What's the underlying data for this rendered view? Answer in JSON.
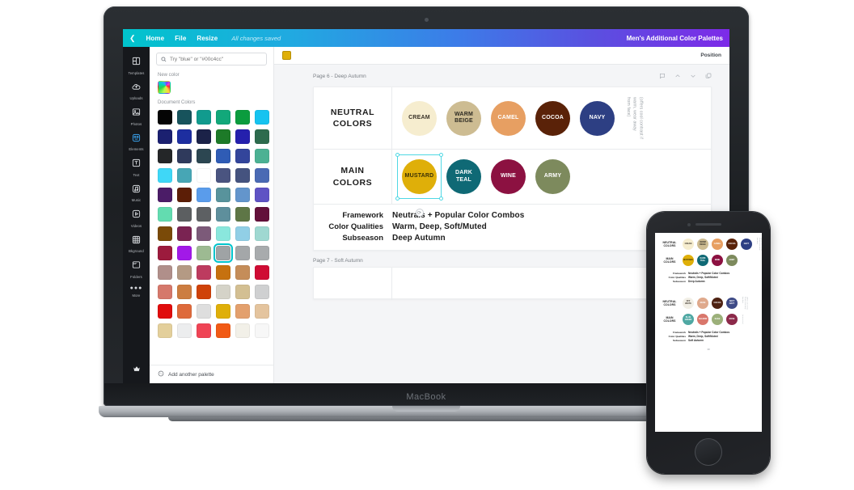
{
  "topbar": {
    "back_icon": "chevron-left-icon",
    "home": "Home",
    "file": "File",
    "resize": "Resize",
    "saved_status": "All changes saved",
    "doc_title": "Men's Additional Color Palettes",
    "gradient_from": "#00c4cc",
    "gradient_to": "#7d2ae8"
  },
  "sidebar": {
    "items": [
      {
        "label": "Templates",
        "icon": "templates-icon",
        "active": false
      },
      {
        "label": "Uploads",
        "icon": "upload-cloud-icon",
        "active": false
      },
      {
        "label": "Photos",
        "icon": "photo-icon",
        "active": false
      },
      {
        "label": "Elements",
        "icon": "elements-icon",
        "active": true
      },
      {
        "label": "Text",
        "icon": "text-icon",
        "active": false
      },
      {
        "label": "Music",
        "icon": "music-note-icon",
        "active": false
      },
      {
        "label": "Videos",
        "icon": "video-play-icon",
        "active": false
      },
      {
        "label": "Bkground",
        "icon": "background-grid-icon",
        "active": false
      },
      {
        "label": "Folders",
        "icon": "folder-icon",
        "active": false
      },
      {
        "label": "More",
        "icon": "more-dots-icon",
        "active": false
      }
    ],
    "active_color": "#3aa3f0",
    "crown_icon": "crown-icon"
  },
  "panel": {
    "search_placeholder": "Try \"blue\" or \"#00c4cc\"",
    "search_value": "",
    "search_icon": "search-icon",
    "new_color_label": "New color",
    "new_color_swatch": "rainbow-gradient",
    "document_colors_label": "Document Colors",
    "add_palette_label": "Add another palette",
    "add_palette_icon": "add-palette-icon",
    "selected_swatch_index": 45,
    "selection_outline": "#00c4cc",
    "swatches": [
      "#050505",
      "#17535c",
      "#119b8e",
      "#12a87a",
      "#0b9c3e",
      "#16c3f0",
      "#1b2070",
      "#1d2ea0",
      "#1b2248",
      "#1d7a28",
      "#2520ad",
      "#2d6b4d",
      "#242628",
      "#2f3a5c",
      "#2c4651",
      "#2f5cb5",
      "#33459b",
      "#4cb193",
      "#3fd7f7",
      "#47a6b5",
      "#45b martin",
      "#4a5480",
      "#45537f",
      "#4a6ab4",
      "#4b1c67",
      "#5c1e06",
      "#5a9ceb",
      "#58939c",
      "#6395cc",
      "#5f53c4",
      "#63dcb0",
      "#5c5f61",
      "#5d6063",
      "#5e8f9c",
      "#5e7646",
      "#63103a",
      "#7a4a08",
      "#7a2352",
      "#7c5a79",
      "#8ae7dd",
      "#91cfe6",
      "#9fd8d1",
      "#9c1b3d",
      "#a219e8",
      "#9dba92",
      "#9fa3a5",
      "#a4a7a9",
      "#a8abad",
      "#b08f8a",
      "#b49a84",
      "#bd3b5f",
      "#c6710f",
      "#c58d59",
      "#cf0c34",
      "#d5786b",
      "#cc7d41",
      "#cf4209",
      "#d5d3c8",
      "#d3bf92",
      "#cfd0d1",
      "#e00c0c",
      "#de6a3b",
      "#dedede",
      "#dfaf09",
      "#e3a06d",
      "#e4c49e",
      "#e3cf9b",
      "#ecedee",
      "#ef4455",
      "#f15a15",
      "#f2f0e8",
      "#f7f7f7"
    ]
  },
  "canvas_toolbar": {
    "color_chip": "#dfaf09",
    "position_label": "Position"
  },
  "pages": [
    {
      "header": "Page 6 - Deep Autumn",
      "header_icons": [
        "note-icon",
        "chevron-up-icon",
        "chevron-down-icon",
        "duplicate-icon"
      ],
      "rows": [
        {
          "label": "NEUTRAL\nCOLORS",
          "circles": [
            {
              "name": "CREAM",
              "hex": "#f6edcf",
              "text": "#3a3328"
            },
            {
              "name": "WARM\nBEIGE",
              "hex": "#cdbc92",
              "text": "#2c2a22"
            },
            {
              "name": "CAMEL",
              "hex": "#e79f62",
              "text": "#ffffff"
            },
            {
              "name": "COCOA",
              "hex": "#5a2208",
              "text": "#ffffff"
            },
            {
              "name": "NAVY",
              "hex": "#2d3f83",
              "text": "#ffffff"
            }
          ],
          "note": "(offers cool contrast if warm, wear away from face)"
        },
        {
          "label": "MAIN\nCOLORS",
          "circles": [
            {
              "name": "MUSTARD",
              "hex": "#dfaf09",
              "text": "#3a3005",
              "selected": true
            },
            {
              "name": "DARK\nTEAL",
              "hex": "#0f6975",
              "text": "#ffffff"
            },
            {
              "name": "WINE",
              "hex": "#8c1141",
              "text": "#ffffff"
            },
            {
              "name": "ARMY",
              "hex": "#7d8a5d",
              "text": "#ffffff"
            }
          ],
          "note": ""
        }
      ],
      "meta": [
        {
          "key": "Framework",
          "value": "Neutrals + Popular Color Combos"
        },
        {
          "key": "Color Qualities",
          "value": "Warm, Deep, Soft/Muted"
        },
        {
          "key": "Subseason",
          "value": "Deep Autumn"
        }
      ]
    },
    {
      "header": "Page 7 - Soft Autumn",
      "header_icons": [],
      "rows": [],
      "meta": []
    }
  ],
  "phone": {
    "sections": [
      {
        "rows": [
          {
            "label": "NEUTRAL\nCOLORS",
            "circles": [
              {
                "name": "CREAM",
                "hex": "#f6edcf",
                "text": "#3a3328"
              },
              {
                "name": "WARM\nBEIGE",
                "hex": "#cdbc92",
                "text": "#2c2a22"
              },
              {
                "name": "CAMEL",
                "hex": "#e79f62",
                "text": "#ffffff"
              },
              {
                "name": "COCOA",
                "hex": "#5a2208",
                "text": "#ffffff"
              },
              {
                "name": "NAVY",
                "hex": "#2d3f83",
                "text": "#ffffff"
              }
            ],
            "note": "(offers cool contrast if warm, wear away from face)"
          },
          {
            "label": "MAIN\nCOLORS",
            "circles": [
              {
                "name": "MUSTARD",
                "hex": "#dfaf09",
                "text": "#3a3005"
              },
              {
                "name": "DARK\nTEAL",
                "hex": "#0f6975",
                "text": "#ffffff"
              },
              {
                "name": "WINE",
                "hex": "#8c1141",
                "text": "#ffffff"
              },
              {
                "name": "ARMY",
                "hex": "#7d8a5d",
                "text": "#ffffff"
              }
            ],
            "note": ""
          }
        ],
        "meta": [
          {
            "key": "Framework",
            "value": "Neutrals + Popular Color Combos"
          },
          {
            "key": "Color Qualities",
            "value": "Warm, Deep, Soft/Muted"
          },
          {
            "key": "Subseason",
            "value": "Deep Autumn"
          }
        ]
      },
      {
        "rows": [
          {
            "label": "NEUTRAL\nCOLORS",
            "circles": [
              {
                "name": "OFF\nWHITE",
                "hex": "#f2efe6",
                "text": "#3a3328"
              },
              {
                "name": "NUDE",
                "hex": "#dfa98c",
                "text": "#ffffff"
              },
              {
                "name": "COCOA",
                "hex": "#4e2212",
                "text": "#ffffff"
              },
              {
                "name": "SOFT\nNAVY",
                "hex": "#3e4a86",
                "text": "#ffffff"
              }
            ],
            "note": "(offers cool contrast if warm, wear away from face)"
          },
          {
            "label": "MAIN\nCOLORS",
            "circles": [
              {
                "name": "BLUE\nGREEN",
                "hex": "#4fa8a3",
                "text": "#ffffff"
              },
              {
                "name": "SALMON",
                "hex": "#d9766b",
                "text": "#ffffff"
              },
              {
                "name": "SAGE",
                "hex": "#9cb07a",
                "text": "#ffffff"
              },
              {
                "name": "ROSE",
                "hex": "#8c2a4a",
                "text": "#ffffff"
              }
            ],
            "note": "(so so so nice)"
          }
        ],
        "meta": [
          {
            "key": "Framework",
            "value": "Neutrals + Popular Color Combos"
          },
          {
            "key": "Color Qualities",
            "value": "Warm, Deep, Soft/Muted"
          },
          {
            "key": "Subseason",
            "value": "Soft Autumn"
          }
        ],
        "page_number": "38"
      }
    ]
  },
  "macbook": {
    "brand": "MacBook"
  }
}
